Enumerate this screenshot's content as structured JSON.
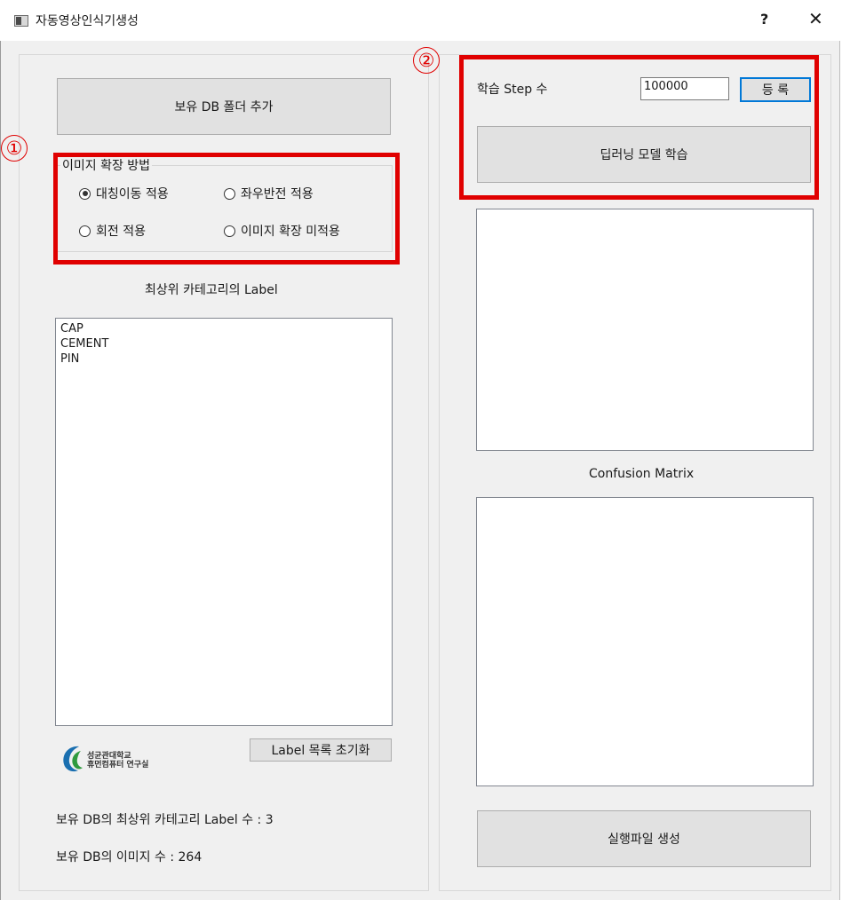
{
  "window": {
    "title": "자동영상인식기생성",
    "help_label": "?",
    "close_label": "✕"
  },
  "left": {
    "add_db_button": "보유 DB 폴더 추가",
    "augmentation": {
      "title": "이미지 확장 방법",
      "options": [
        {
          "label": "대칭이동 적용",
          "checked": true
        },
        {
          "label": "좌우반전 적용",
          "checked": false
        },
        {
          "label": "회전 적용",
          "checked": false
        },
        {
          "label": "이미지 확장 미적용",
          "checked": false
        }
      ]
    },
    "top_category_caption": "최상위 카테고리의 Label",
    "label_list": [
      "CAP",
      "CEMENT",
      "PIN"
    ],
    "reset_button": "Label 목록 초기화",
    "logo": {
      "line1": "성균관대학교",
      "line2": "휴먼컴퓨터 연구실"
    },
    "label_count_text": "보유 DB의 최상위 카테고리 Label 수 : 3",
    "image_count_text": "보유 DB의 이미지 수 : 264"
  },
  "right": {
    "step_label": "학습 Step 수",
    "step_value": "100000",
    "register_button": "등 록",
    "train_button": "딥러닝 모델 학습",
    "confusion_caption": "Confusion Matrix",
    "build_button": "실행파일 생성"
  },
  "annotations": {
    "marker1": "①",
    "marker2": "②",
    "color": "#e00000"
  }
}
